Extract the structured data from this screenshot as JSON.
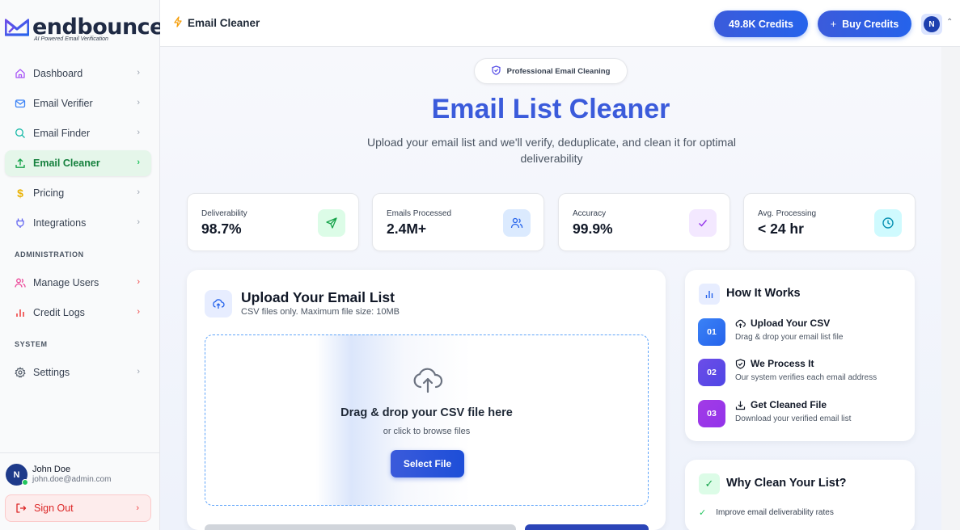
{
  "brand": {
    "name": "endbounce",
    "tagline": "AI Powered Email Verification"
  },
  "sidebar": {
    "items": [
      {
        "label": "Dashboard",
        "icon": "home-icon",
        "color": "#a855f7"
      },
      {
        "label": "Email Verifier",
        "icon": "mail-icon",
        "color": "#3b82f6"
      },
      {
        "label": "Email Finder",
        "icon": "search-icon",
        "color": "#14b8a6"
      },
      {
        "label": "Email Cleaner",
        "icon": "upload-icon",
        "color": "#16a34a",
        "active": true
      },
      {
        "label": "Pricing",
        "icon": "dollar-icon",
        "color": "#eab308"
      },
      {
        "label": "Integrations",
        "icon": "plug-icon",
        "color": "#6366f1"
      }
    ],
    "admin_label": "ADMINISTRATION",
    "admin_items": [
      {
        "label": "Manage Users",
        "icon": "users-icon",
        "color": "#ec4899"
      },
      {
        "label": "Credit Logs",
        "icon": "bar-chart-icon",
        "color": "#ef4444"
      }
    ],
    "system_label": "SYSTEM",
    "system_items": [
      {
        "label": "Settings",
        "icon": "gear-icon",
        "color": "#4b5563"
      }
    ],
    "user": {
      "initial": "N",
      "name": "John Doe",
      "email": "john.doe@admin.com",
      "online": true
    },
    "signout_label": "Sign Out"
  },
  "topbar": {
    "title": "Email Cleaner",
    "credits_label": "49.8K Credits",
    "buy_label": "Buy Credits",
    "avatar_initial": "N"
  },
  "hero": {
    "badge": "Professional Email Cleaning",
    "title": "Email List Cleaner",
    "subtitle": "Upload your email list and we'll verify, deduplicate, and clean it for optimal deliverability"
  },
  "stats": [
    {
      "label": "Deliverability",
      "value": "98.7%",
      "icon": "send-icon",
      "bg": "#dcfce7",
      "fg": "#16a34a"
    },
    {
      "label": "Emails Processed",
      "value": "2.4M+",
      "icon": "users-icon",
      "bg": "#dbeafe",
      "fg": "#2563eb"
    },
    {
      "label": "Accuracy",
      "value": "99.9%",
      "icon": "check-icon",
      "bg": "#f3e8ff",
      "fg": "#9333ea"
    },
    {
      "label": "Avg. Processing",
      "value": "< 24 hr",
      "icon": "clock-icon",
      "bg": "#cffafe",
      "fg": "#0891b2"
    }
  ],
  "upload": {
    "title": "Upload Your Email List",
    "subtitle": "CSV files only. Maximum file size: 10MB",
    "drop_title": "Drag & drop your CSV file here",
    "drop_sub": "or click to browse files",
    "select_label": "Select File"
  },
  "how": {
    "title": "How It Works",
    "steps": [
      {
        "num": "01",
        "title": "Upload Your CSV",
        "desc": "Drag & drop your email list file",
        "color": "#3b82f6"
      },
      {
        "num": "02",
        "title": "We Process It",
        "desc": "Our system verifies each email address",
        "color": "#6d4de8"
      },
      {
        "num": "03",
        "title": "Get Cleaned File",
        "desc": "Download your verified email list",
        "color": "#a23be6"
      }
    ]
  },
  "why": {
    "title": "Why Clean Your List?",
    "items": [
      "Improve email deliverability rates"
    ]
  }
}
